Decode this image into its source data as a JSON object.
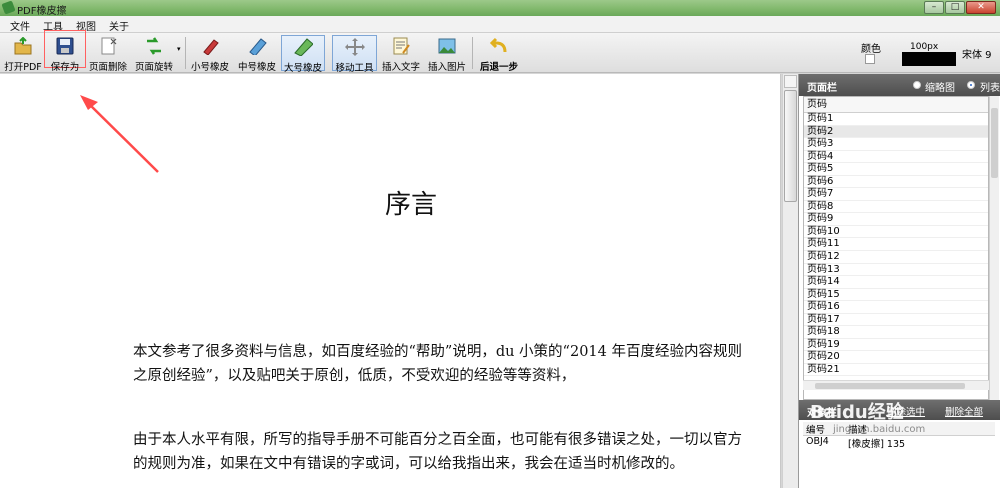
{
  "window": {
    "title": "PDF橡皮擦",
    "min": "–",
    "max": "□",
    "close": "✕"
  },
  "menu": [
    "文件",
    "工具",
    "视图",
    "关于"
  ],
  "toolbar": {
    "buttons": [
      {
        "label": "打开PDF",
        "icon": "open-folder-icon"
      },
      {
        "label": "保存为",
        "icon": "floppy-disk-icon"
      },
      {
        "label": "页面删除",
        "icon": "page-delete-icon"
      },
      {
        "label": "页面旋转",
        "icon": "rotate-arrows-icon"
      },
      {
        "label": "小号橡皮",
        "icon": "small-eraser-icon"
      },
      {
        "label": "中号橡皮",
        "icon": "medium-eraser-icon"
      },
      {
        "label": "大号橡皮",
        "icon": "large-eraser-icon"
      },
      {
        "label": "移动工具",
        "icon": "move-tool-icon"
      },
      {
        "label": "插入文字",
        "icon": "insert-text-icon"
      },
      {
        "label": "插入图片",
        "icon": "insert-image-icon"
      },
      {
        "label": "后退一步",
        "icon": "undo-icon"
      }
    ],
    "color_label": "颜色",
    "size_value": "100px",
    "font_value": "宋体 9"
  },
  "document": {
    "title": "序言",
    "paragraphs": [
      "本文参考了很多资料与信息，如百度经验的“帮助”说明，du 小策的“2014 年百度经验内容规则之原创经验”，以及贴吧关于原创，低质，不受欢迎的经验等等资料，",
      "由于本人水平有限，所写的指导手册不可能百分之百全面，也可能有很多错误之处，一切以官方的规则为准，如果在文中有错误的字或词，可以给我指出来，我会在适当时机修改的。"
    ]
  },
  "page_panel": {
    "title": "页面栏",
    "view_options": [
      "缩略图",
      "列表"
    ],
    "selected_view": "列表",
    "column_header": "页码",
    "pages": [
      "页码1",
      "页码2",
      "页码3",
      "页码4",
      "页码5",
      "页码6",
      "页码7",
      "页码8",
      "页码9",
      "页码10",
      "页码11",
      "页码12",
      "页码13",
      "页码14",
      "页码15",
      "页码16",
      "页码17",
      "页码18",
      "页码19",
      "页码20",
      "页码21"
    ],
    "selected_page": "页码2"
  },
  "object_panel": {
    "title": "对象栏",
    "delete_selected": "删除选中",
    "delete_all": "删除全部",
    "columns": [
      "编号",
      "描述"
    ],
    "rows": [
      {
        "id": "OBJ4",
        "desc": "[橡皮擦] 135"
      }
    ]
  },
  "watermark": {
    "main": "Baidu经验",
    "sub": "jingyan.baidu.com"
  },
  "colors": {
    "highlight_red": "#ff3b3b",
    "titlebar_green": "#7fb76a",
    "panel_header": "#5a5a5a"
  }
}
